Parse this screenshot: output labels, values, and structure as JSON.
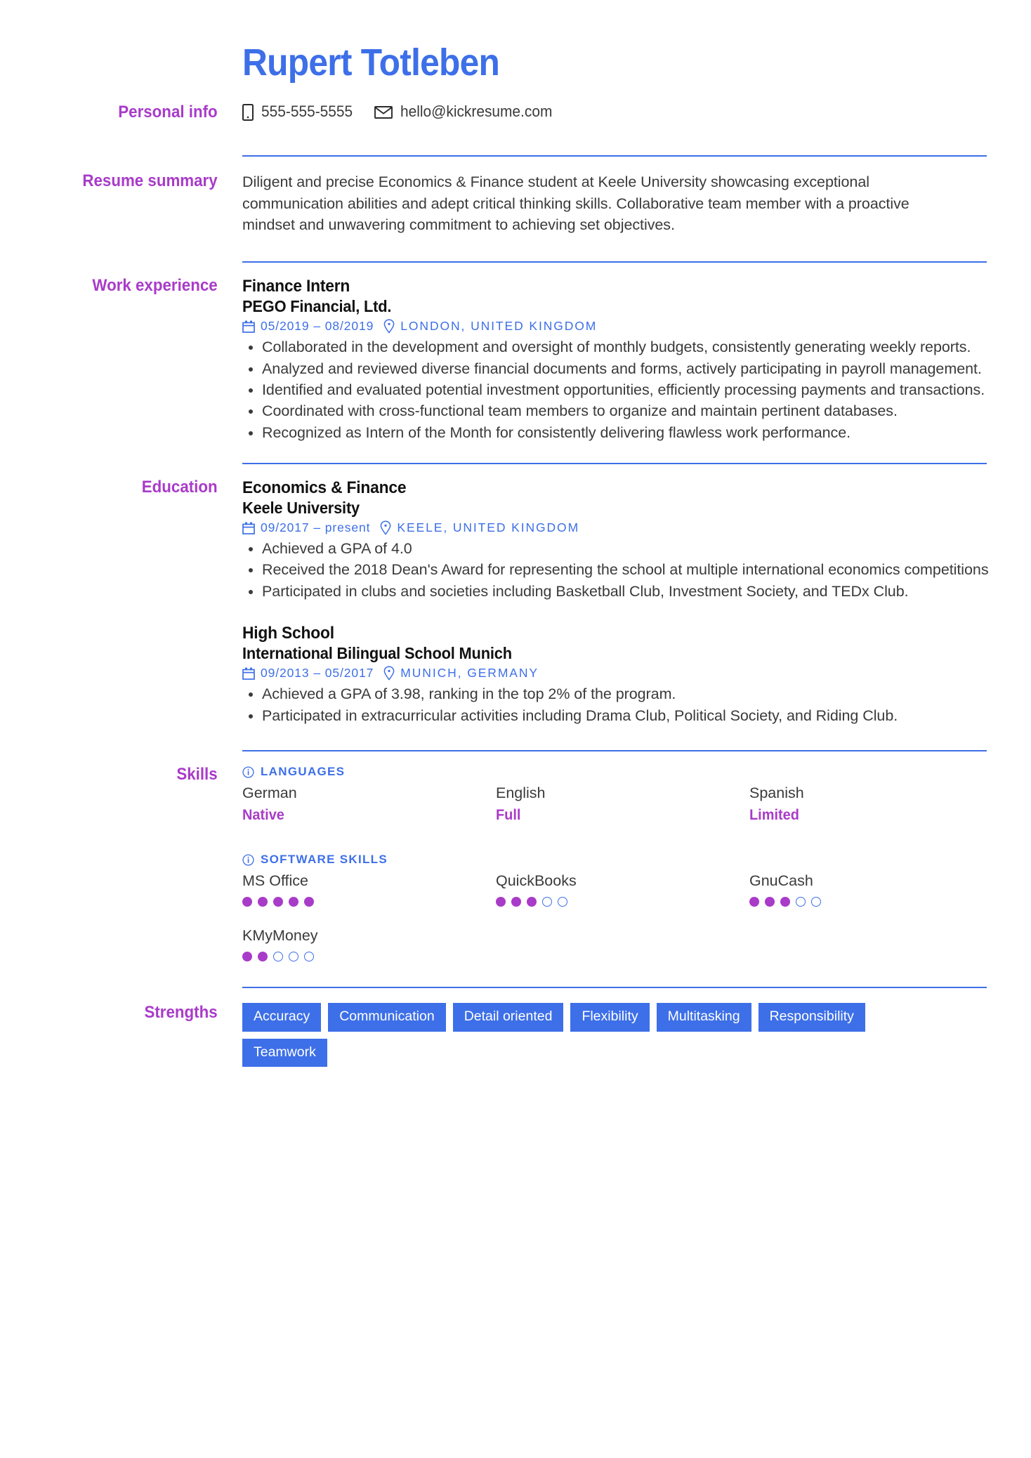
{
  "header": {
    "name": "Rupert Totleben"
  },
  "colors": {
    "accent_blue": "#3D6FE8",
    "accent_purple": "#A93BC9",
    "body_text": "#3A3A3A",
    "heading_text": "#111111"
  },
  "sections": {
    "personal_info": {
      "label": "Personal info",
      "phone": "555-555-5555",
      "email": "hello@kickresume.com"
    },
    "resume_summary": {
      "label": "Resume summary",
      "text": "Diligent and precise Economics & Finance student at Keele University showcasing exceptional communication abilities and adept critical thinking skills. Collaborative team member with a proactive mindset and unwavering commitment to achieving set objectives."
    },
    "work_experience": {
      "label": "Work experience",
      "entries": [
        {
          "title": "Finance Intern",
          "organization": "PEGO Financial, Ltd.",
          "date": "05/2019 – 08/2019",
          "location": "LONDON, UNITED KINGDOM",
          "bullets": [
            "Collaborated in the development and oversight of monthly budgets, consistently generating weekly reports.",
            "Analyzed and reviewed diverse financial documents and forms, actively participating in payroll management.",
            "Identified and evaluated potential investment opportunities, efficiently processing payments and transactions.",
            "Coordinated with cross-functional team members to organize and maintain pertinent databases.",
            "Recognized as Intern of the Month for consistently delivering flawless work performance."
          ]
        }
      ]
    },
    "education": {
      "label": "Education",
      "entries": [
        {
          "title": "Economics & Finance",
          "organization": "Keele University",
          "date": "09/2017 – present",
          "location": "KEELE, UNITED KINGDOM",
          "bullets": [
            "Achieved a GPA of 4.0",
            "Received the 2018 Dean's Award for representing the school at multiple international economics competitions",
            "Participated in clubs and societies including Basketball Club, Investment Society, and TEDx Club."
          ]
        },
        {
          "title": "High School",
          "organization": "International Bilingual School Munich",
          "date": "09/2013 – 05/2017",
          "location": "MUNICH, GERMANY",
          "bullets": [
            "Achieved a GPA of 3.98, ranking in the top 2% of the program.",
            "Participated in extracurricular activities including Drama Club, Political Society, and Riding Club."
          ]
        }
      ]
    },
    "skills": {
      "label": "Skills",
      "groups": [
        {
          "heading": "LANGUAGES",
          "type": "level",
          "items": [
            {
              "name": "German",
              "level": "Native"
            },
            {
              "name": "English",
              "level": "Full"
            },
            {
              "name": "Spanish",
              "level": "Limited"
            }
          ]
        },
        {
          "heading": "SOFTWARE SKILLS",
          "type": "rating",
          "max_rating": 5,
          "items": [
            {
              "name": "MS Office",
              "rating": 5
            },
            {
              "name": "QuickBooks",
              "rating": 3
            },
            {
              "name": "GnuCash",
              "rating": 3
            },
            {
              "name": "KMyMoney",
              "rating": 2
            }
          ]
        }
      ]
    },
    "strengths": {
      "label": "Strengths",
      "tags": [
        "Accuracy",
        "Communication",
        "Detail oriented",
        "Flexibility",
        "Multitasking",
        "Responsibility",
        "Teamwork"
      ]
    }
  },
  "icons": {
    "phone": "phone-icon",
    "email": "envelope-icon",
    "date": "calendar-icon",
    "location": "map-pin-icon",
    "info": "info-circle-icon"
  }
}
